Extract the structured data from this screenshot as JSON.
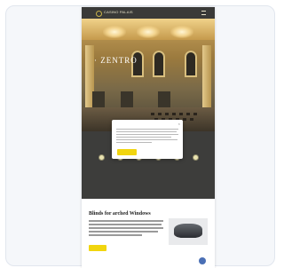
{
  "header": {
    "logo_text": "CASINO PALAIS",
    "menu_icon": "hamburger-menu-icon"
  },
  "hero": {
    "title": "· ZENTRO"
  },
  "dark_section": {
    "heading": "",
    "steps": [
      {
        "label": ""
      },
      {
        "label": ""
      },
      {
        "label": ""
      },
      {
        "label": ""
      },
      {
        "label": ""
      },
      {
        "label": ""
      }
    ]
  },
  "cookie_dialog": {
    "title": "",
    "accept_label": "",
    "reject_label": "",
    "preferences_label": ""
  },
  "content": {
    "title": "Blinds for arched Windows",
    "cta_label": ""
  },
  "colors": {
    "accent": "#f1d50e",
    "header_bg": "#3a3a38",
    "dark_section_bg": "#3d3d3b"
  }
}
